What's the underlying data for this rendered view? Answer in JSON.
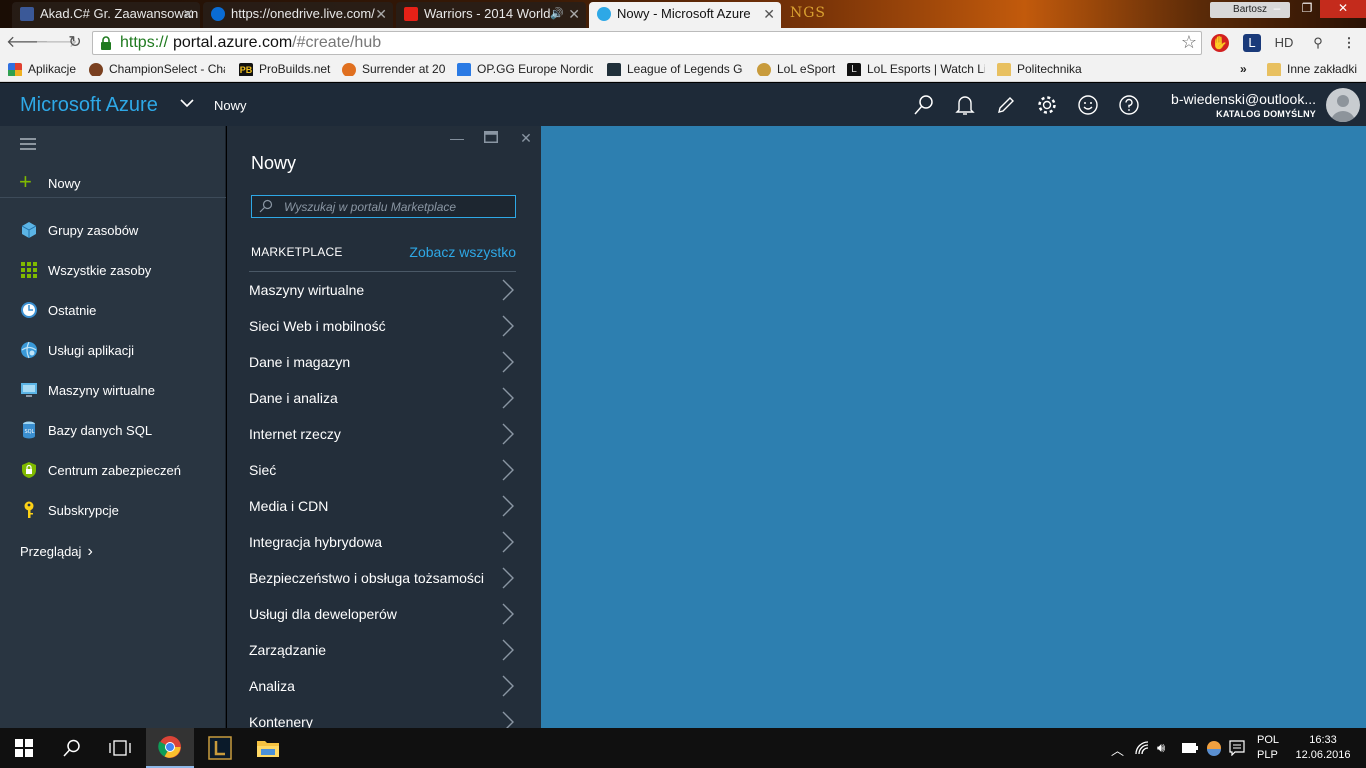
{
  "browser": {
    "tabs": [
      {
        "title": "Akad.C# Gr. Zaawansowan",
        "favicon_color": "#3b5998"
      },
      {
        "title": "https://onedrive.live.com/",
        "favicon_color": "#0a6cd4"
      },
      {
        "title": "Warriors - 2014 World",
        "favicon_color": "#e62117"
      },
      {
        "title": "Nowy - Microsoft Azure",
        "favicon_color": "#2ea8e6"
      }
    ],
    "profile_name": "Bartosz",
    "decor_text": "NGS",
    "url": {
      "scheme": "https://",
      "host": "portal.azure.com",
      "path": "/#create/hub"
    },
    "extension_hd_label": "HD",
    "bookmarks": [
      {
        "label": "Aplikacje",
        "icon_color": "#e04030"
      },
      {
        "label": "ChampionSelect - Cha",
        "icon_color": "#7a4020"
      },
      {
        "label": "ProBuilds.net",
        "icon_color": "#111111"
      },
      {
        "label": "Surrender at 20",
        "icon_color": "#e07020"
      },
      {
        "label": "OP.GG Europe Nordic",
        "icon_color": "#2a7ae4"
      },
      {
        "label": "League of Legends Ga",
        "icon_color": "#20303a"
      },
      {
        "label": "LoL eSport",
        "icon_color": "#c89b3c"
      },
      {
        "label": "LoL Esports | Watch Li",
        "icon_color": "#111111"
      },
      {
        "label": "Politechnika",
        "icon_color": "#e8c060"
      }
    ],
    "bookmarks_overflow": "»",
    "other_bookmarks": "Inne zakładki"
  },
  "azure": {
    "brand": "Microsoft Azure",
    "breadcrumb": "Nowy",
    "user_name": "b-wiedenski@outlook...",
    "user_directory": "KATALOG DOMYŚLNY",
    "accent": "#2ea8e6"
  },
  "nav": {
    "new_label": "Nowy",
    "items": [
      {
        "label": "Grupy zasobów",
        "icon": "resource-groups-icon"
      },
      {
        "label": "Wszystkie zasoby",
        "icon": "all-resources-icon"
      },
      {
        "label": "Ostatnie",
        "icon": "recent-icon"
      },
      {
        "label": "Usługi aplikacji",
        "icon": "app-services-icon"
      },
      {
        "label": "Maszyny wirtualne",
        "icon": "virtual-machines-icon"
      },
      {
        "label": "Bazy danych SQL",
        "icon": "sql-databases-icon"
      },
      {
        "label": "Centrum zabezpieczeń",
        "icon": "security-center-icon"
      },
      {
        "label": "Subskrypcje",
        "icon": "subscriptions-icon"
      }
    ],
    "browse_label": "Przeglądaj"
  },
  "blade": {
    "title": "Nowy",
    "search_placeholder": "Wyszukaj w portalu Marketplace",
    "marketplace_header": "MARKETPLACE",
    "see_all": "Zobacz wszystko",
    "categories": [
      "Maszyny wirtualne",
      "Sieci Web i mobilność",
      "Dane i magazyn",
      "Dane i analiza",
      "Internet rzeczy",
      "Sieć",
      "Media i CDN",
      "Integracja hybrydowa",
      "Bezpieczeństwo i obsługa tożsamości",
      "Usługi dla deweloperów",
      "Zarządzanie",
      "Analiza",
      "Kontenery"
    ]
  },
  "dashboard": {
    "background": "#2d7fb0"
  },
  "taskbar": {
    "language_1": "POL",
    "language_2": "PLP",
    "time": "16:33",
    "date": "12.06.2016"
  }
}
